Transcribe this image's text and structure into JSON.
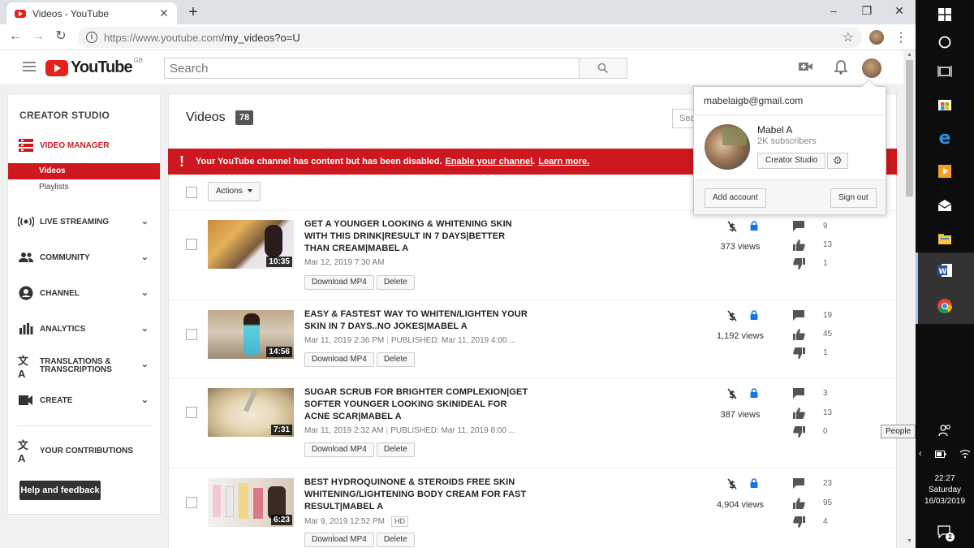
{
  "browser": {
    "tab_title": "Videos - YouTube",
    "new_tab": "+",
    "url_prefix": "https://www.youtube.com",
    "url_path": "/my_videos?o=U",
    "window_controls": [
      "–",
      "❐",
      "✕"
    ]
  },
  "masthead": {
    "logo_text": "YouTube",
    "region": "GB",
    "search_placeholder": "Search"
  },
  "sidebar": {
    "title": "CREATOR STUDIO",
    "video_manager": "VIDEO MANAGER",
    "sub_items": [
      "Videos",
      "Playlists"
    ],
    "sections": [
      {
        "label": "LIVE STREAMING",
        "icon": "live-streaming-icon"
      },
      {
        "label": "COMMUNITY",
        "icon": "community-icon"
      },
      {
        "label": "CHANNEL",
        "icon": "channel-icon"
      },
      {
        "label": "ANALYTICS",
        "icon": "analytics-icon"
      },
      {
        "label": "TRANSLATIONS &",
        "label2": "TRANSCRIPTIONS",
        "icon": "translations-icon"
      },
      {
        "label": "CREATE",
        "icon": "create-icon"
      }
    ],
    "contributions": "YOUR CONTRIBUTIONS",
    "help_button": "Help and feedback"
  },
  "main": {
    "title": "Videos",
    "count": "78",
    "search_placeholder": "Sea",
    "alert": {
      "text": "Your YouTube channel has content but has been disabled.",
      "enable_link": "Enable your channel",
      "learn_link": "Learn more."
    },
    "actions_label": "Actions",
    "download_label": "Download MP4",
    "delete_label": "Delete",
    "videos": [
      {
        "title": "GET A YOUNGER LOOKING & WHITENING SKIN WITH THIS DRINK|RESULT IN 7 DAYS|BETTER THAN CREAM|MABEL A",
        "date": "Mar 12, 2019 7:30 AM",
        "published": "",
        "duration": "10:35",
        "views": "373 views",
        "comments": "9",
        "likes": "13",
        "dislikes": "1"
      },
      {
        "title": "EASY & FASTEST WAY TO WHITEN/LIGHTEN YOUR SKIN IN 7 DAYS..NO JOKES|MABEL A",
        "date": "Mar 11, 2019 2:36 PM",
        "published": "PUBLISHED: Mar 11, 2019 4:00 ...",
        "duration": "14:56",
        "views": "1,192 views",
        "comments": "19",
        "likes": "45",
        "dislikes": "1"
      },
      {
        "title": "SUGAR SCRUB FOR BRIGHTER COMPLEXION|GET SOFTER YOUNGER LOOKING SKINIDEAL FOR ACNE SCAR|MABEL A",
        "date": "Mar 11, 2019 2:32 AM",
        "published": "PUBLISHED: Mar 11, 2019 8:00 ...",
        "duration": "7:31",
        "views": "387 views",
        "comments": "3",
        "likes": "13",
        "dislikes": "0"
      },
      {
        "title": "BEST HYDROQUINONE & STEROIDS FREE SKIN WHITENING/LIGHTENING BODY CREAM FOR FAST RESULT|MABEL A",
        "date": "Mar 9, 2019 12:52 PM",
        "published": "",
        "hd": "HD",
        "duration": "6:23",
        "views": "4,904 views",
        "comments": "23",
        "likes": "95",
        "dislikes": "4"
      }
    ]
  },
  "account_popup": {
    "email": "mabelaigb@gmail.com",
    "name": "Mabel A",
    "subscribers": "2K subscribers",
    "creator_studio": "Creator Studio",
    "add_account": "Add account",
    "sign_out": "Sign out"
  },
  "taskbar": {
    "people_tooltip": "People",
    "time": "22:27",
    "day": "Saturday",
    "date": "16/03/2019",
    "notifications": "2"
  },
  "colors": {
    "yt_red": "#cc181e",
    "taskbar": "#0d0d0d"
  }
}
